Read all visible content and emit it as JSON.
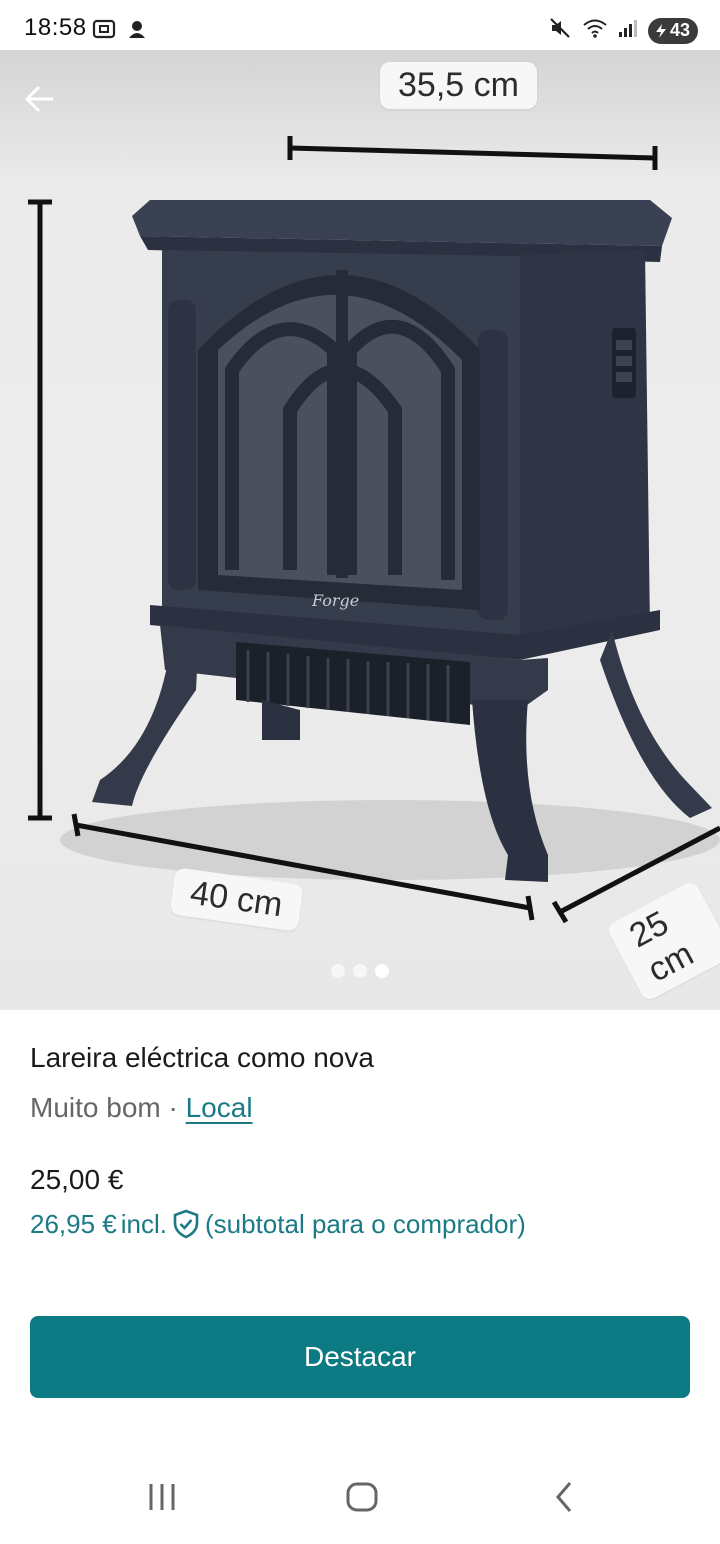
{
  "status_bar": {
    "time": "18:58",
    "battery": "43",
    "icons": [
      "screenshot-icon",
      "notification-icon",
      "mute-icon",
      "wifi-icon",
      "signal-icon",
      "battery-icon"
    ]
  },
  "gallery": {
    "dimension_labels": {
      "top": "35,5 cm",
      "width": "40 cm",
      "depth": "25 cm"
    },
    "page_count": 3,
    "active_page": 3
  },
  "item": {
    "title": "Lareira eléctrica como nova",
    "condition": "Muito bom",
    "separator": "·",
    "location_link": "Local",
    "price": "25,00 €",
    "price_incl_amount": "26,95 €",
    "price_incl_label": "incl.",
    "price_incl_note": "(subtotal para o comprador)"
  },
  "actions": {
    "primary_label": "Destacar"
  },
  "colors": {
    "accent": "#0c7a83",
    "link": "#1b7a86",
    "stove": "#343b4b"
  }
}
